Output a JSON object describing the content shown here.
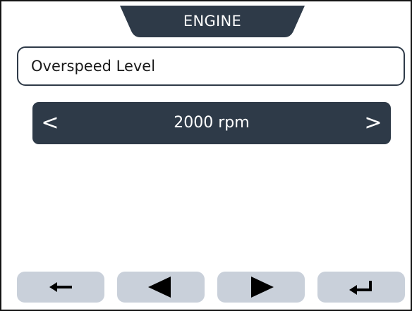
{
  "header": {
    "title": "ENGINE"
  },
  "parameter": {
    "name": "Overspeed Level",
    "value": "2000 rpm",
    "prev_glyph": "<",
    "next_glyph": ">"
  },
  "softkeys": [
    {
      "id": "back",
      "icon": "back-arrow-icon"
    },
    {
      "id": "previous",
      "icon": "triangle-left-icon"
    },
    {
      "id": "next",
      "icon": "triangle-right-icon"
    },
    {
      "id": "enter",
      "icon": "enter-return-icon"
    }
  ],
  "colors": {
    "dark_panel": "#2e3a48",
    "softkey_bg": "#c9d0da",
    "icon": "#000000",
    "frame": "#141414"
  }
}
